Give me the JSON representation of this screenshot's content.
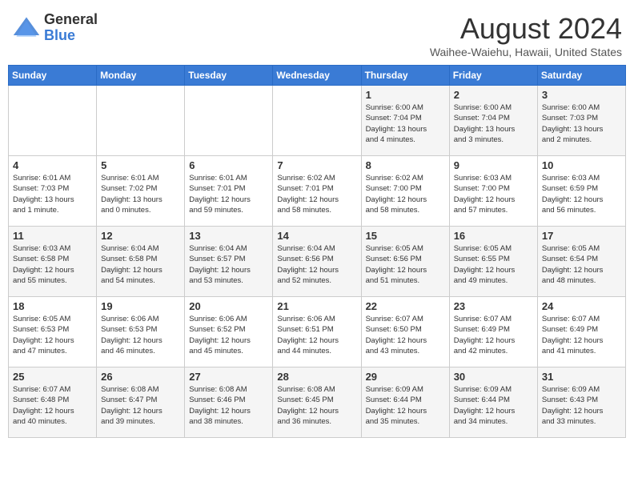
{
  "header": {
    "logo_general": "General",
    "logo_blue": "Blue",
    "month_title": "August 2024",
    "location": "Waihee-Waiehu, Hawaii, United States"
  },
  "weekdays": [
    "Sunday",
    "Monday",
    "Tuesday",
    "Wednesday",
    "Thursday",
    "Friday",
    "Saturday"
  ],
  "weeks": [
    [
      {
        "day": "",
        "info": ""
      },
      {
        "day": "",
        "info": ""
      },
      {
        "day": "",
        "info": ""
      },
      {
        "day": "",
        "info": ""
      },
      {
        "day": "1",
        "info": "Sunrise: 6:00 AM\nSunset: 7:04 PM\nDaylight: 13 hours\nand 4 minutes."
      },
      {
        "day": "2",
        "info": "Sunrise: 6:00 AM\nSunset: 7:04 PM\nDaylight: 13 hours\nand 3 minutes."
      },
      {
        "day": "3",
        "info": "Sunrise: 6:00 AM\nSunset: 7:03 PM\nDaylight: 13 hours\nand 2 minutes."
      }
    ],
    [
      {
        "day": "4",
        "info": "Sunrise: 6:01 AM\nSunset: 7:03 PM\nDaylight: 13 hours\nand 1 minute."
      },
      {
        "day": "5",
        "info": "Sunrise: 6:01 AM\nSunset: 7:02 PM\nDaylight: 13 hours\nand 0 minutes."
      },
      {
        "day": "6",
        "info": "Sunrise: 6:01 AM\nSunset: 7:01 PM\nDaylight: 12 hours\nand 59 minutes."
      },
      {
        "day": "7",
        "info": "Sunrise: 6:02 AM\nSunset: 7:01 PM\nDaylight: 12 hours\nand 58 minutes."
      },
      {
        "day": "8",
        "info": "Sunrise: 6:02 AM\nSunset: 7:00 PM\nDaylight: 12 hours\nand 58 minutes."
      },
      {
        "day": "9",
        "info": "Sunrise: 6:03 AM\nSunset: 7:00 PM\nDaylight: 12 hours\nand 57 minutes."
      },
      {
        "day": "10",
        "info": "Sunrise: 6:03 AM\nSunset: 6:59 PM\nDaylight: 12 hours\nand 56 minutes."
      }
    ],
    [
      {
        "day": "11",
        "info": "Sunrise: 6:03 AM\nSunset: 6:58 PM\nDaylight: 12 hours\nand 55 minutes."
      },
      {
        "day": "12",
        "info": "Sunrise: 6:04 AM\nSunset: 6:58 PM\nDaylight: 12 hours\nand 54 minutes."
      },
      {
        "day": "13",
        "info": "Sunrise: 6:04 AM\nSunset: 6:57 PM\nDaylight: 12 hours\nand 53 minutes."
      },
      {
        "day": "14",
        "info": "Sunrise: 6:04 AM\nSunset: 6:56 PM\nDaylight: 12 hours\nand 52 minutes."
      },
      {
        "day": "15",
        "info": "Sunrise: 6:05 AM\nSunset: 6:56 PM\nDaylight: 12 hours\nand 51 minutes."
      },
      {
        "day": "16",
        "info": "Sunrise: 6:05 AM\nSunset: 6:55 PM\nDaylight: 12 hours\nand 49 minutes."
      },
      {
        "day": "17",
        "info": "Sunrise: 6:05 AM\nSunset: 6:54 PM\nDaylight: 12 hours\nand 48 minutes."
      }
    ],
    [
      {
        "day": "18",
        "info": "Sunrise: 6:05 AM\nSunset: 6:53 PM\nDaylight: 12 hours\nand 47 minutes."
      },
      {
        "day": "19",
        "info": "Sunrise: 6:06 AM\nSunset: 6:53 PM\nDaylight: 12 hours\nand 46 minutes."
      },
      {
        "day": "20",
        "info": "Sunrise: 6:06 AM\nSunset: 6:52 PM\nDaylight: 12 hours\nand 45 minutes."
      },
      {
        "day": "21",
        "info": "Sunrise: 6:06 AM\nSunset: 6:51 PM\nDaylight: 12 hours\nand 44 minutes."
      },
      {
        "day": "22",
        "info": "Sunrise: 6:07 AM\nSunset: 6:50 PM\nDaylight: 12 hours\nand 43 minutes."
      },
      {
        "day": "23",
        "info": "Sunrise: 6:07 AM\nSunset: 6:49 PM\nDaylight: 12 hours\nand 42 minutes."
      },
      {
        "day": "24",
        "info": "Sunrise: 6:07 AM\nSunset: 6:49 PM\nDaylight: 12 hours\nand 41 minutes."
      }
    ],
    [
      {
        "day": "25",
        "info": "Sunrise: 6:07 AM\nSunset: 6:48 PM\nDaylight: 12 hours\nand 40 minutes."
      },
      {
        "day": "26",
        "info": "Sunrise: 6:08 AM\nSunset: 6:47 PM\nDaylight: 12 hours\nand 39 minutes."
      },
      {
        "day": "27",
        "info": "Sunrise: 6:08 AM\nSunset: 6:46 PM\nDaylight: 12 hours\nand 38 minutes."
      },
      {
        "day": "28",
        "info": "Sunrise: 6:08 AM\nSunset: 6:45 PM\nDaylight: 12 hours\nand 36 minutes."
      },
      {
        "day": "29",
        "info": "Sunrise: 6:09 AM\nSunset: 6:44 PM\nDaylight: 12 hours\nand 35 minutes."
      },
      {
        "day": "30",
        "info": "Sunrise: 6:09 AM\nSunset: 6:44 PM\nDaylight: 12 hours\nand 34 minutes."
      },
      {
        "day": "31",
        "info": "Sunrise: 6:09 AM\nSunset: 6:43 PM\nDaylight: 12 hours\nand 33 minutes."
      }
    ]
  ]
}
